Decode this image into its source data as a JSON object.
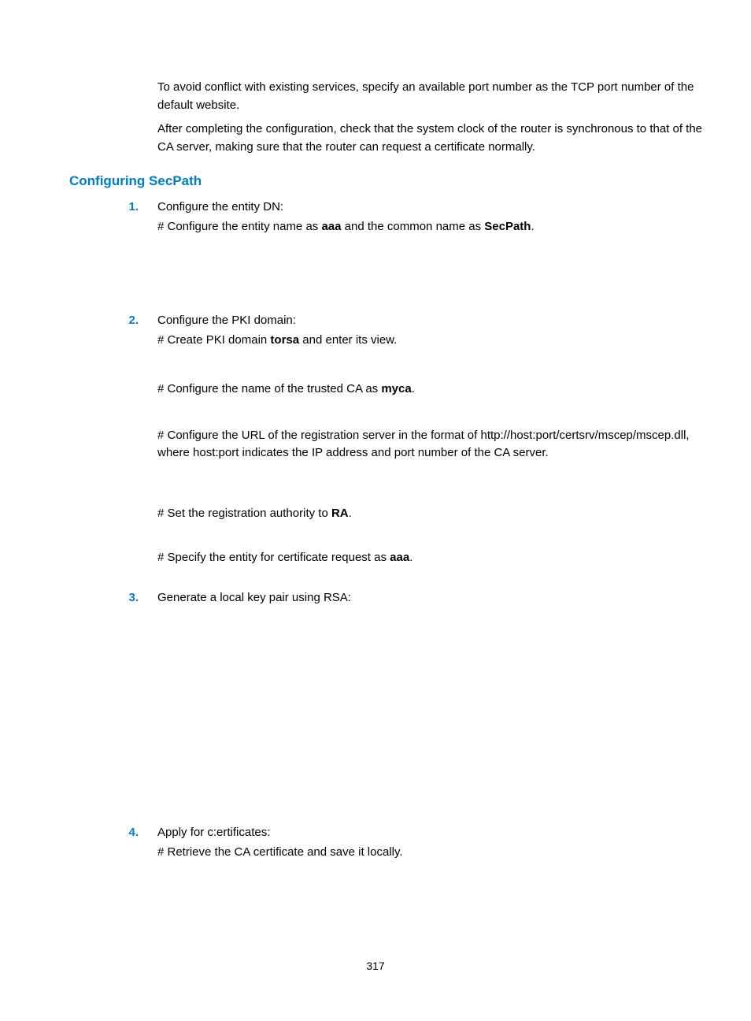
{
  "intro": {
    "p1": "To avoid conflict with existing services, specify an available port number as the TCP port number of the default website.",
    "p2": "After completing the configuration, check that the system clock of the router is synchronous to that of the CA server, making sure that the router can request a certificate normally."
  },
  "heading": "Configuring SecPath",
  "steps": {
    "n1": "1.",
    "s1_title": "Configure the entity DN:",
    "s1_a_pre": "# Configure the entity name as ",
    "s1_a_b1": "aaa",
    "s1_a_mid": " and the common name as ",
    "s1_a_b2": "SecPath",
    "s1_a_post": ".",
    "n2": "2.",
    "s2_title": "Configure the PKI domain:",
    "s2_a_pre": "# Create PKI domain ",
    "s2_a_b1": "torsa",
    "s2_a_post": " and enter its view.",
    "s2_b_pre": "# Configure the name of the trusted CA as ",
    "s2_b_b1": "myca",
    "s2_b_post": ".",
    "s2_c": "# Configure the URL of the registration server in the format of http://host:port/certsrv/mscep/mscep.dll, where host:port indicates the IP address and port number of the CA server.",
    "s2_d_pre": "# Set the registration authority to ",
    "s2_d_b1": "RA",
    "s2_d_post": ".",
    "s2_e_pre": "# Specify the entity for certificate request as ",
    "s2_e_b1": "aaa",
    "s2_e_post": ".",
    "n3": "3.",
    "s3_title": "Generate a local key pair using RSA:",
    "n4": "4.",
    "s4_title": "Apply for c:ertificates:",
    "s4_a": "# Retrieve the CA certificate and save it locally."
  },
  "pageNumber": "317"
}
